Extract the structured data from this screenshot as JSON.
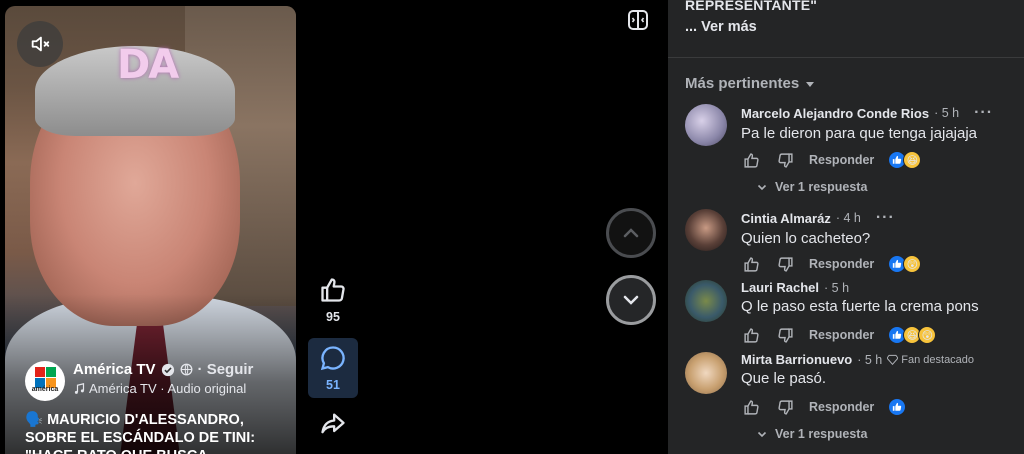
{
  "video": {
    "watermark": "DA",
    "channel_name": "América TV",
    "follow_label": "· Seguir",
    "audio_label": "América TV · Audio original",
    "caption": "🗣️ MAURICIO D'ALESSANDRO, SOBRE EL ESCÁNDALO DE TINI: \"HACE RATO QUE BUSCA",
    "logo_text": "américa",
    "likes": "95",
    "comments": "51"
  },
  "panel": {
    "desc_tail": "REPRESENTANTE\"",
    "see_more": "... Ver más",
    "sort_label": "Más pertinentes",
    "reply_label": "Responder",
    "comments": [
      {
        "name": "Marcelo Alejandro Conde Rios",
        "time": "· 5 h",
        "text": "Pa le dieron para que tenga jajajaja",
        "replies": "Ver 1 respuesta",
        "badge": ""
      },
      {
        "name": "Cintia Almaráz",
        "time": "· 4 h",
        "text": "Quien lo cacheteo?",
        "replies": "",
        "badge": ""
      },
      {
        "name": "Lauri Rachel",
        "time": "· 5 h",
        "text": "Q le paso esta fuerte la crema pons",
        "replies": "",
        "badge": ""
      },
      {
        "name": "Mirta Barrionuevo",
        "time": "· 5 h",
        "text": "Que le pasó.",
        "replies": "Ver 1 respuesta",
        "badge": "Fan destacado"
      }
    ]
  },
  "colors": {
    "panel_bg": "#242526",
    "accent": "#1877f2",
    "comment_active": "#1c2b40"
  }
}
